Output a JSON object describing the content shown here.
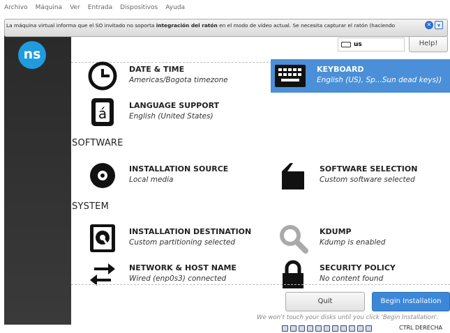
{
  "host_menu": [
    "Archivo",
    "Máquina",
    "Ver",
    "Entrada",
    "Dispositivos",
    "Ayuda"
  ],
  "notification": {
    "text_before": "La máquina virtual informa que el SO invitado no soporta ",
    "text_bold": "integración del ratón",
    "text_after": " en el modo de vídeo actual. Se necesita capturar el ratón (haciendo"
  },
  "header": {
    "keyboard_indicator": "us",
    "help_label": "Help!"
  },
  "logo_text": "ns",
  "sections": {
    "software": "SOFTWARE",
    "system": "SYSTEM"
  },
  "spokes": {
    "datetime": {
      "title": "DATE & TIME",
      "status": "Americas/Bogota timezone",
      "icon": "clock-icon"
    },
    "keyboard": {
      "title": "KEYBOARD",
      "status": "English (US), Sp...Sun dead keys))",
      "icon": "keyboard-icon"
    },
    "language": {
      "title": "LANGUAGE SUPPORT",
      "status": "English (United States)",
      "icon": "language-icon"
    },
    "install_source": {
      "title": "INSTALLATION SOURCE",
      "status": "Local media",
      "icon": "disc-icon"
    },
    "software_selection": {
      "title": "SOFTWARE SELECTION",
      "status": "Custom software selected",
      "icon": "package-icon"
    },
    "install_dest": {
      "title": "INSTALLATION DESTINATION",
      "status": "Custom partitioning selected",
      "icon": "harddisk-icon"
    },
    "kdump": {
      "title": "KDUMP",
      "status": "Kdump is enabled",
      "icon": "magnifier-icon"
    },
    "network": {
      "title": "NETWORK & HOST NAME",
      "status": "Wired (enp0s3) connected",
      "icon": "network-arrows-icon"
    },
    "security": {
      "title": "SECURITY POLICY",
      "status": "No content found",
      "icon": "lock-icon"
    }
  },
  "buttons": {
    "quit": "Quit",
    "begin": "Begin Installation"
  },
  "notice": "We won't touch your disks until you click 'Begin Installation'.",
  "statusbar": {
    "host_key": "CTRL DERECHA"
  },
  "colors": {
    "accent": "#3d87d8",
    "selected": "#4a8fd8",
    "sidebar": "#2e2e2e",
    "logo": "#1f9bde"
  }
}
